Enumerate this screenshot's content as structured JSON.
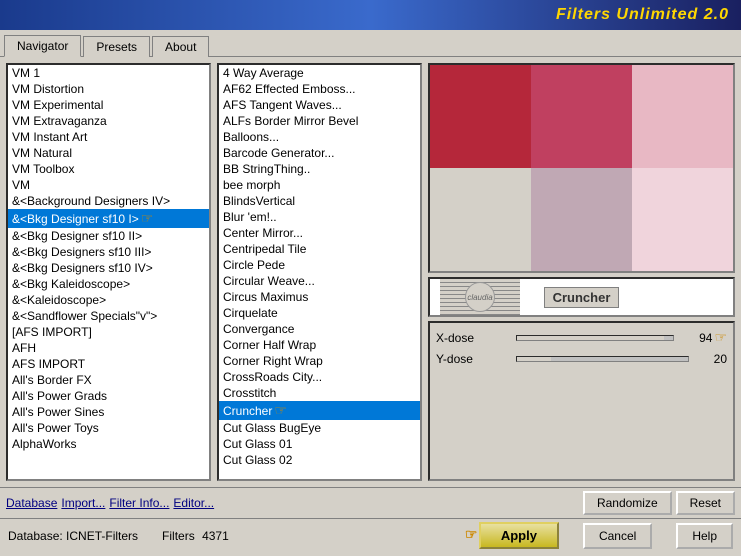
{
  "titleBar": {
    "text": "Filters Unlimited 2.0"
  },
  "tabs": [
    {
      "label": "Navigator",
      "active": true
    },
    {
      "label": "Presets",
      "active": false
    },
    {
      "label": "About",
      "active": false
    }
  ],
  "leftPanel": {
    "items": [
      "VM 1",
      "VM Distortion",
      "VM Experimental",
      "VM Extravaganza",
      "VM Instant Art",
      "VM Natural",
      "VM Toolbox",
      "VM",
      "&<Background Designers IV>",
      "&<Bkg Designer sf10 I>",
      "&<Bkg Designer sf10 II>",
      "&<Bkg Designers sf10 III>",
      "&<Bkg Designers sf10 IV>",
      "&<Bkg Kaleidoscope>",
      "&<Kaleidoscope>",
      "&<Sandflower Specials\"v\">",
      "[AFS IMPORT]",
      "AFH",
      "AFS IMPORT",
      "All's Border FX",
      "All's Power Grads",
      "All's Power Sines",
      "All's Power Toys",
      "AlphaWorks"
    ],
    "selectedIndex": 9
  },
  "middlePanel": {
    "items": [
      "4 Way Average",
      "AF62 Effected Emboss...",
      "AFS Tangent Waves...",
      "ALFs Border Mirror Bevel",
      "Balloons...",
      "Barcode Generator...",
      "BB StringThing..",
      "bee morph",
      "BlindsVertical",
      "Blur 'em!..",
      "Center Mirror...",
      "Centripedal Tile",
      "Circle Pede",
      "Circular Weave...",
      "Circus Maximus",
      "Cirquelate",
      "Convergance",
      "Corner Half Wrap",
      "Corner Right Wrap",
      "CrossRoads City...",
      "Crosstitch",
      "Cruncher",
      "Cut Glass BugEye",
      "Cut Glass 01",
      "Cut Glass 02"
    ],
    "selectedIndex": 21,
    "selectedItem": "Cruncher"
  },
  "preview": {
    "filterName": "Cruncher",
    "colors": {
      "topLeft": "#b5273a",
      "topMiddle": "#c04060",
      "topRight": "#e8b8c4",
      "bottomLeft": "#d4d0c8",
      "bottomMiddle": "#c0a8b4",
      "bottomRight": "#f0d4dc"
    }
  },
  "parameters": {
    "xDose": {
      "label": "X-dose",
      "value": 94,
      "min": 0,
      "max": 100,
      "fillPercent": 94
    },
    "yDose": {
      "label": "Y-dose",
      "value": 20,
      "min": 0,
      "max": 100,
      "fillPercent": 20
    }
  },
  "bottomBar": {
    "database": "Database",
    "import": "Import...",
    "filterInfo": "Filter Info...",
    "editor": "Editor...",
    "randomize": "Randomize",
    "reset": "Reset"
  },
  "statusBar": {
    "databaseLabel": "Database:",
    "databaseValue": "ICNET-Filters",
    "filtersLabel": "Filters",
    "filtersValue": "4371",
    "apply": "Apply",
    "cancel": "Cancel",
    "help": "Help"
  }
}
